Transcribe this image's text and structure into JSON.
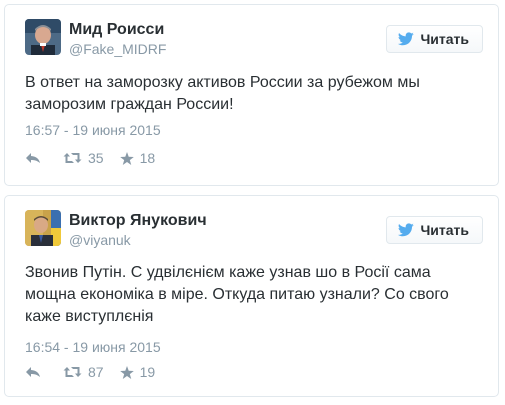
{
  "tweets": [
    {
      "author_name": "Мид Роисси",
      "handle": "@Fake_MIDRF",
      "follow_label": "Читать",
      "text": "В ответ на заморозку активов России за рубежом мы заморозим граждан России!",
      "timestamp": "16:57 - 19 июня 2015",
      "retweets": "35",
      "favorites": "18"
    },
    {
      "author_name": "Виктор Янукович",
      "handle": "@viyanuk",
      "follow_label": "Читать",
      "text": "Звонив Путін. С удвілєнієм каже узнав шо в Росії сама мощна економіка в міре. Откуда питаю узнали? Со свого каже виступлєнія",
      "timestamp": "16:54 - 19 июня 2015",
      "retweets": "87",
      "favorites": "19"
    }
  ],
  "colors": {
    "text": "#292f33",
    "muted": "#8899a6",
    "border": "#e1e8ed",
    "twitter_blue": "#55acee"
  },
  "icons": {
    "follow": "twitter-bird-icon",
    "reply": "reply-icon",
    "retweet": "retweet-icon",
    "favorite": "star-icon"
  }
}
